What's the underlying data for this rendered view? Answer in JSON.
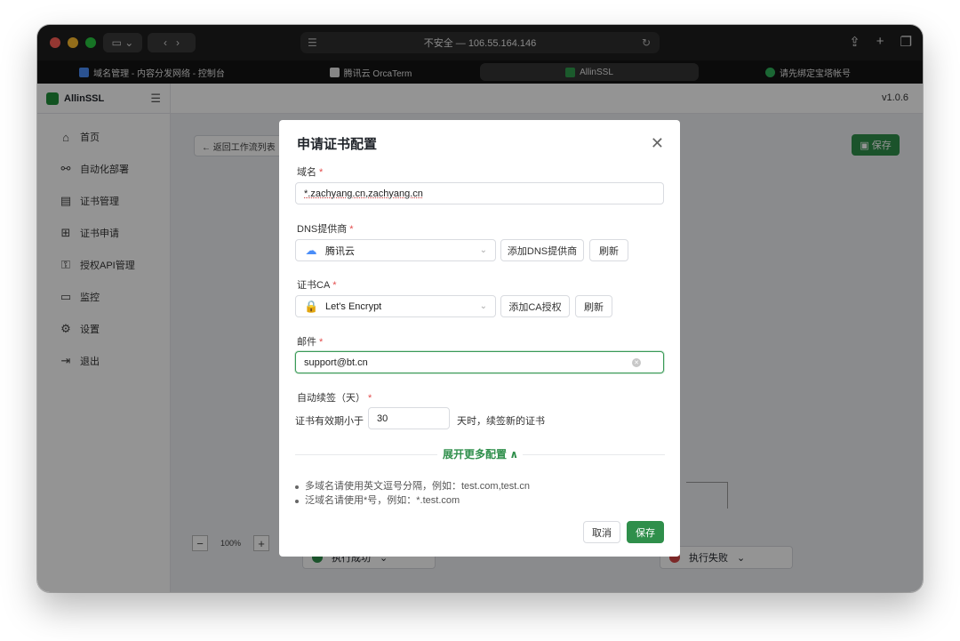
{
  "browser": {
    "address": "不安全 — 106.55.164.146",
    "tabs": [
      {
        "label": "域名管理 - 内容分发网络 - 控制台",
        "active": false,
        "icon_color": "#4a8df8"
      },
      {
        "label": "腾讯云 OrcaTerm",
        "active": false,
        "icon_color": "#e6e6e6"
      },
      {
        "label": "AllinSSL",
        "active": true,
        "icon_color": "#2f9b4c"
      },
      {
        "label": "请先绑定宝塔帐号",
        "active": false,
        "icon_color": "#2fb15a"
      }
    ]
  },
  "sidebar": {
    "brand": "AllinSSL",
    "items": [
      {
        "label": "首页",
        "icon": "home-icon",
        "glyph": "⌂"
      },
      {
        "label": "自动化部署",
        "icon": "workflow-icon",
        "glyph": "⚯"
      },
      {
        "label": "证书管理",
        "icon": "certificate-icon",
        "glyph": "▤"
      },
      {
        "label": "证书申请",
        "icon": "add-box-icon",
        "glyph": "⊞"
      },
      {
        "label": "授权API管理",
        "icon": "api-key-icon",
        "glyph": "⚿"
      },
      {
        "label": "监控",
        "icon": "monitor-icon",
        "glyph": "▭"
      },
      {
        "label": "设置",
        "icon": "gear-icon",
        "glyph": "⚙"
      },
      {
        "label": "退出",
        "icon": "logout-icon",
        "glyph": "⇥"
      }
    ]
  },
  "main": {
    "version": "v1.0.6",
    "back_label": "← 返回工作流列表",
    "save_label": "保存",
    "zoom_level": "100%",
    "node_left_label": "执行成功",
    "node_right_label": "执行失败"
  },
  "modal": {
    "title": "申请证书配置",
    "domain_label": "域名",
    "domain_value": "*.zachyang.cn,zachyang.cn",
    "dns_label": "DNS提供商",
    "dns_value": "腾讯云",
    "dns_add_button": "添加DNS提供商",
    "dns_refresh_button": "刷新",
    "ca_label": "证书CA",
    "ca_value": "Let's Encrypt",
    "ca_add_button": "添加CA授权",
    "ca_refresh_button": "刷新",
    "email_label": "邮件",
    "email_value": "support@bt.cn",
    "renew_label": "自动续签（天）",
    "renew_prefix": "证书有效期小于",
    "renew_days": "30",
    "renew_suffix": "天时，续签新的证书",
    "expand_label": "展开更多配置 ∧",
    "tips": [
      "多域名请使用英文逗号分隔，例如：test.com,test.cn",
      "泛域名请使用*号，例如：*.test.com"
    ],
    "cancel_button": "取消",
    "save_button": "保存"
  },
  "colors": {
    "accent": "#2f8f4b",
    "required": "#e34d4d"
  }
}
